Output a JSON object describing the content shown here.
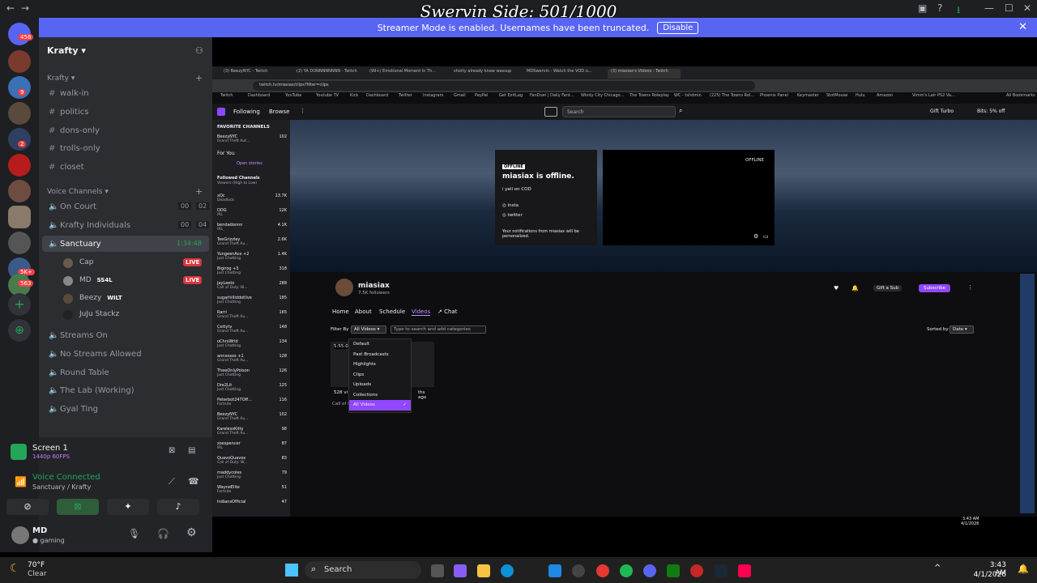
{
  "overlay_title": "Swervin Side: 501/1000",
  "banner": {
    "text": "Streamer Mode is enabled. Usernames have been truncated.",
    "button": "Disable"
  },
  "servers": {
    "badges": [
      "458",
      "9",
      "2",
      "5K+",
      "563"
    ]
  },
  "guild": {
    "name": "Krafty",
    "text_category": "Krafty",
    "text_channels": [
      "walk-in",
      "politics",
      "dons-only",
      "trolls-only",
      "closet"
    ],
    "voice_category": "Voice Channels",
    "voice_channels": [
      {
        "name": "On Court",
        "a": "00",
        "b": "02"
      },
      {
        "name": "Krafty Individuals",
        "a": "00",
        "b": "04"
      },
      {
        "name": "Sanctuary",
        "time": "1:34:48"
      }
    ],
    "voice_users": [
      {
        "name": "Cap",
        "live": "LIVE"
      },
      {
        "name": "MD",
        "tag": "SS4L",
        "live": "LIVE"
      },
      {
        "name": "Beezy",
        "tag": "WILT"
      },
      {
        "name": "JuJu Stackz"
      }
    ],
    "more_channels": [
      "Streams On",
      "No Streams Allowed",
      "Round Table",
      "The Lab (Working)",
      "Gyal Ting"
    ]
  },
  "panel": {
    "screen_title": "Screen 1",
    "screen_sub": "1440p 60FPS",
    "voice_status": "Voice Connected",
    "voice_sub": "Sanctuary / Krafty",
    "user": "MD",
    "user_status": "gaming"
  },
  "browser": {
    "tabs": [
      "(3) BeezyNYC - Twitch",
      "(2) YA DONNNNNNNN - Twitch",
      "(99+) Emotional Moment In Th...",
      "shorty already knew wassup",
      "MDSwervin - Watch the VOD o...",
      "(3) miasiax's Videos - Twitch"
    ],
    "url": "twitch.tv/miasiax/clips?filter=clips",
    "bookmarks": [
      "Twitch",
      "Dashboard",
      "YouTube",
      "Youtube TV",
      "Kick",
      "Dashboard",
      "Twitter",
      "Instagram",
      "Gmail",
      "PayPal",
      "Get ExitLag",
      "FanDuel | Daily Fant...",
      "Windy City Chicago...",
      "The Towns Roleplay",
      "WC - tshdmin",
      "(225) The Towns Rol...",
      "Phoenix Panel",
      "Keymaster",
      "StotMouse",
      "Hulu",
      "Amazon",
      "Vimm's Lair PS2 Va...",
      "All Bookmarks"
    ]
  },
  "twitch": {
    "nav": {
      "following": "Following",
      "browse": "Browse",
      "search": "Search",
      "gift": "Gift Turbo",
      "bits": "Bits: 5% off"
    },
    "sidebar": {
      "favorites": "FAVORITE CHANNELS",
      "for_you": "For You",
      "open_stories": "Open stories",
      "followed": "Followed Channels",
      "sort": "Viewers (High to Low)",
      "channels": [
        {
          "n": "BeezyNYC",
          "g": "Grand Theft Aut...",
          "v": "102"
        },
        {
          "n": "xQc",
          "g": "Deadlock",
          "v": "13.7K"
        },
        {
          "n": "DDG",
          "g": "IRL",
          "v": "12K"
        },
        {
          "n": "bendadonnn",
          "g": "IRL",
          "v": "4.1K"
        },
        {
          "n": "TeeGrizzley",
          "g": "Grand Theft Au...",
          "v": "2.6K"
        },
        {
          "n": "YungeenAce +2",
          "g": "Just Chatting",
          "v": "1.4K"
        },
        {
          "n": "Bigirog +3",
          "g": "Just Chatting",
          "v": "318"
        },
        {
          "n": "JayLeeto",
          "g": "Call of Duty: Bl...",
          "v": "288"
        },
        {
          "n": "sugarhilliddotlive",
          "g": "Just Chatting",
          "v": "185"
        },
        {
          "n": "Rarri",
          "g": "Grand Theft Au...",
          "v": "165"
        },
        {
          "n": "Cettytv",
          "g": "Grand Theft Au...",
          "v": "148"
        },
        {
          "n": "oChrsWrld",
          "g": "Just Chatting",
          "v": "134"
        },
        {
          "n": "annxoxox +1",
          "g": "Grand Theft Au...",
          "v": "128"
        },
        {
          "n": "TheeOnlyPoison",
          "g": "Just Chatting",
          "v": "126"
        },
        {
          "n": "Dre2Lit",
          "g": "Just Chatting",
          "v": "125"
        },
        {
          "n": "Peterbot247Off...",
          "g": "Fortnite",
          "v": "116"
        },
        {
          "n": "BeezyNYC",
          "g": "Grand Theft Au...",
          "v": "102"
        },
        {
          "n": "KarelessKitty",
          "g": "Grand Theft Au...",
          "v": "98"
        },
        {
          "n": "zoespencer",
          "g": "IRL",
          "v": "87"
        },
        {
          "n": "QuavoQuavox",
          "g": "Call of Duty: W...",
          "v": "83"
        },
        {
          "n": "maddycoles",
          "g": "Just Chatting",
          "v": "79"
        },
        {
          "n": "WayneElite",
          "g": "Fortnite",
          "v": "51"
        },
        {
          "n": "IndiansOfficial",
          "g": "",
          "v": "47"
        }
      ]
    },
    "offline": {
      "badge": "OFFLINE",
      "title": "miasiax is offline.",
      "sub": "i yell on COD",
      "insta": "insta",
      "twitter": "twitter",
      "notify": "Your notifications from miasiax will be personalized.",
      "player_badge": "OFFLINE"
    },
    "channel": {
      "name": "miasiax",
      "followers": "7.5K followers",
      "tabs": [
        "Home",
        "About",
        "Schedule",
        "Videos",
        "Chat"
      ],
      "gift": "Gift a Sub",
      "subscribe": "Subscribe",
      "filter_by": "Filter By",
      "filter_value": "All Videos",
      "search_cat": "Type to search and add categories",
      "sorted_by": "Sorted by",
      "sort_value": "Date",
      "dropdown": [
        "Default",
        "Past Broadcasts",
        "Highlights",
        "Clips",
        "Uploads",
        "Collections",
        "All Videos"
      ],
      "video": {
        "time": "5:55:0",
        "views": "528 vi",
        "ago": "ths ago",
        "game": "Call of Duty: Black Ops 6"
      }
    },
    "clock": {
      "time": "3:43 AM",
      "date": "4/1/2026"
    }
  },
  "taskbar": {
    "weather_temp": "70°F",
    "weather_desc": "Clear",
    "search": "Search",
    "time": "3:43 AM",
    "date": "4/1/2026"
  }
}
